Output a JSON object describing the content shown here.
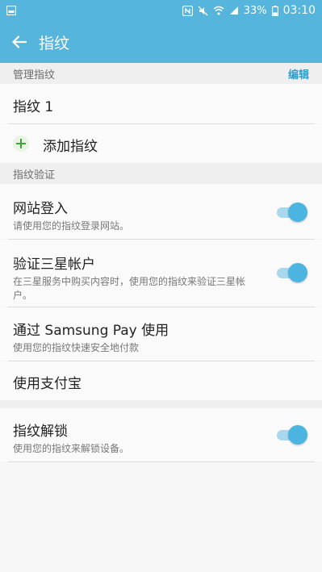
{
  "status_bar": {
    "battery": "33%",
    "time": "03:10"
  },
  "app_bar": {
    "title": "指纹"
  },
  "sections": {
    "manage": {
      "header": "管理指纹",
      "action": "编辑",
      "fingerprint_item": "指纹 1",
      "add_item": "添加指纹"
    },
    "verify": {
      "header": "指纹验证",
      "items": [
        {
          "title": "网站登入",
          "subtitle": "请使用您的指纹登录网站。",
          "toggle_on": true
        },
        {
          "title": "验证三星帐户",
          "subtitle": "在三星服务中购买内容时，使用您的指纹来验证三星帐户。",
          "toggle_on": true
        },
        {
          "title": "通过 Samsung Pay 使用",
          "subtitle": "使用您的指纹快速安全地付款"
        },
        {
          "title": "使用支付宝"
        }
      ]
    },
    "unlock": {
      "title": "指纹解锁",
      "subtitle": "使用您的指纹来解锁设备。",
      "toggle_on": true
    }
  },
  "colors": {
    "accent": "#55b5dc",
    "toggle_on": "#4cb4e0",
    "add_icon": "#3aa63a"
  }
}
